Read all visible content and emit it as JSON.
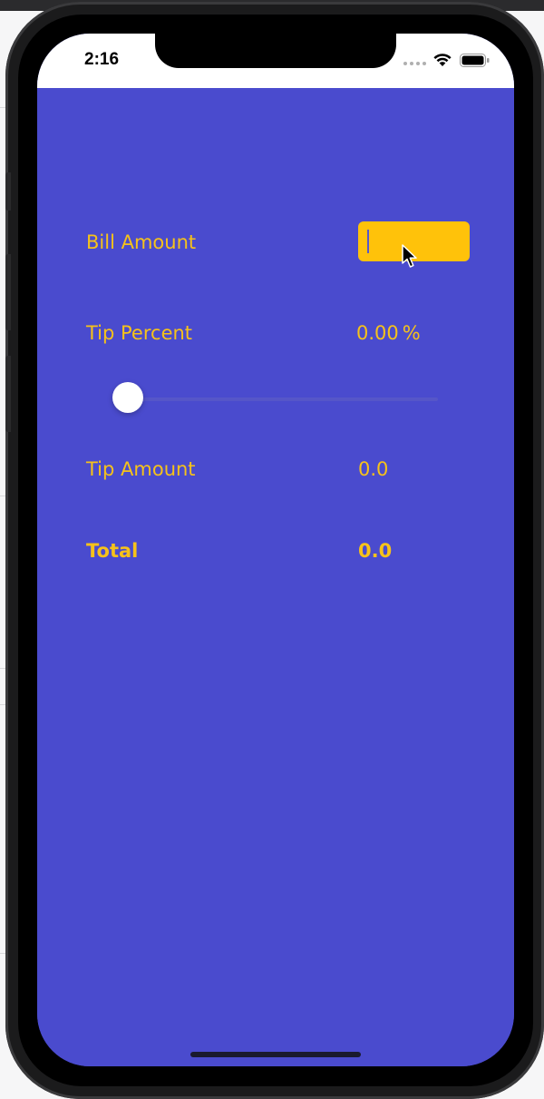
{
  "status_bar": {
    "time": "2:16"
  },
  "bill": {
    "label": "Bill Amount",
    "value": ""
  },
  "tip_percent": {
    "label": "Tip Percent",
    "value": "0.00",
    "suffix": "%",
    "slider_fraction": 0.0
  },
  "tip_amount": {
    "label": "Tip Amount",
    "value": "0.0"
  },
  "total": {
    "label": "Total",
    "value": "0.0"
  },
  "colors": {
    "background": "#4a4bce",
    "accent": "#f6c21a",
    "input_bg": "#ffc20a"
  }
}
